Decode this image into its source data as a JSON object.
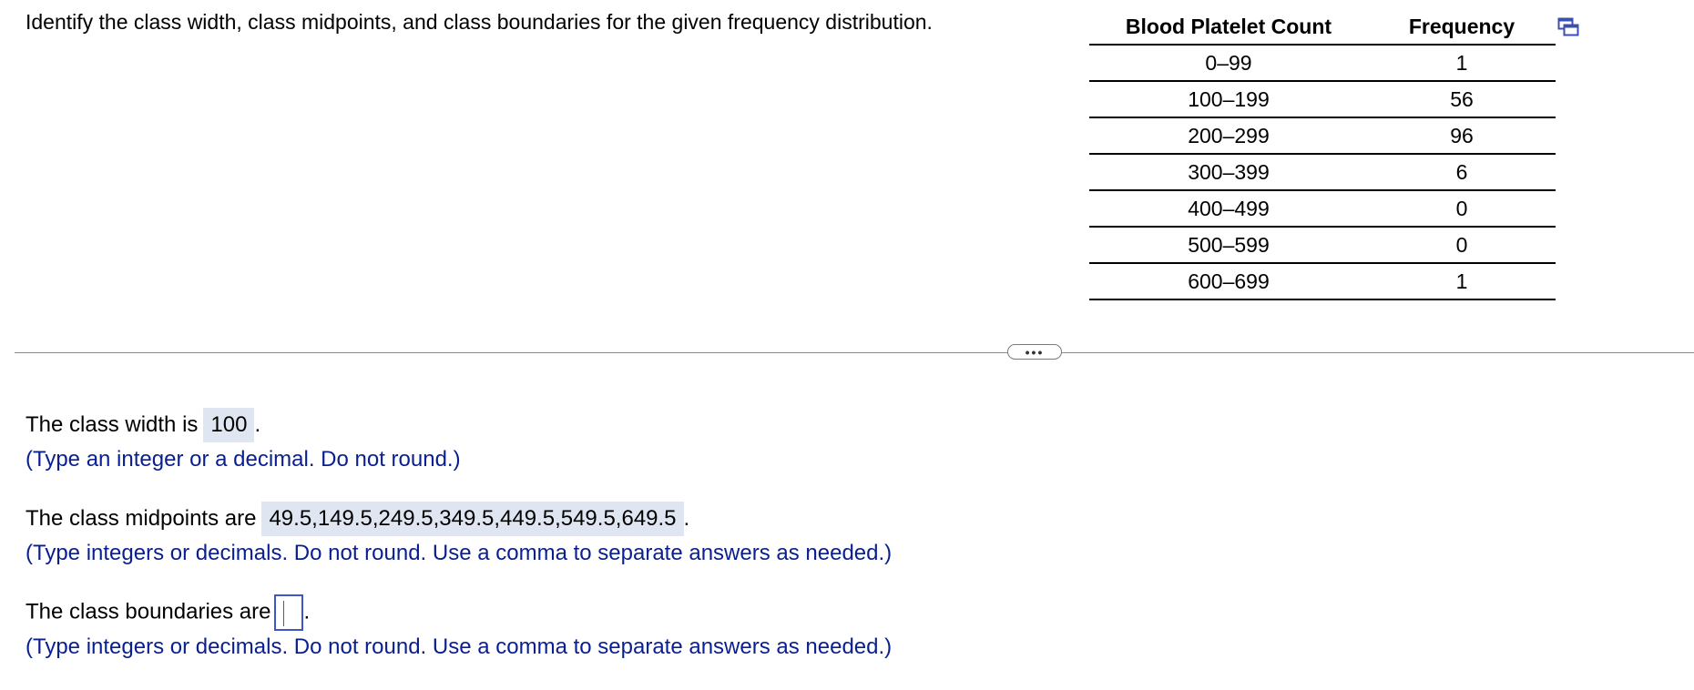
{
  "question": {
    "text": "Identify the class width, class midpoints, and class boundaries for the given frequency distribution."
  },
  "table": {
    "headers": [
      "Blood Platelet Count",
      "Frequency"
    ],
    "rows": [
      {
        "count": "0–99",
        "freq": "1"
      },
      {
        "count": "100–199",
        "freq": "56"
      },
      {
        "count": "200–299",
        "freq": "96"
      },
      {
        "count": "300–399",
        "freq": "6"
      },
      {
        "count": "400–499",
        "freq": "0"
      },
      {
        "count": "500–599",
        "freq": "0"
      },
      {
        "count": "600–699",
        "freq": "1"
      }
    ],
    "popout_icon": "popout-window-icon"
  },
  "divider": {
    "expander_label": "•••"
  },
  "answers": {
    "width": {
      "prefix": "The class width is",
      "value": "100",
      "suffix": ".",
      "hint": "(Type an integer or a decimal. Do not round.)"
    },
    "midpoints": {
      "prefix": "The class midpoints are",
      "value": "49.5,149.5,249.5,349.5,449.5,549.5,649.5",
      "suffix": ".",
      "hint": "(Type integers or decimals. Do not round. Use a comma to separate answers as needed.)"
    },
    "boundaries": {
      "prefix": "The class boundaries are",
      "value": "",
      "suffix": ".",
      "hint": "(Type integers or decimals. Do not round. Use a comma to separate answers as needed.)"
    }
  },
  "colors": {
    "hint_text": "#0a1f8f",
    "answer_box_bg": "#dfe6f1",
    "input_border": "#3e56c8"
  }
}
